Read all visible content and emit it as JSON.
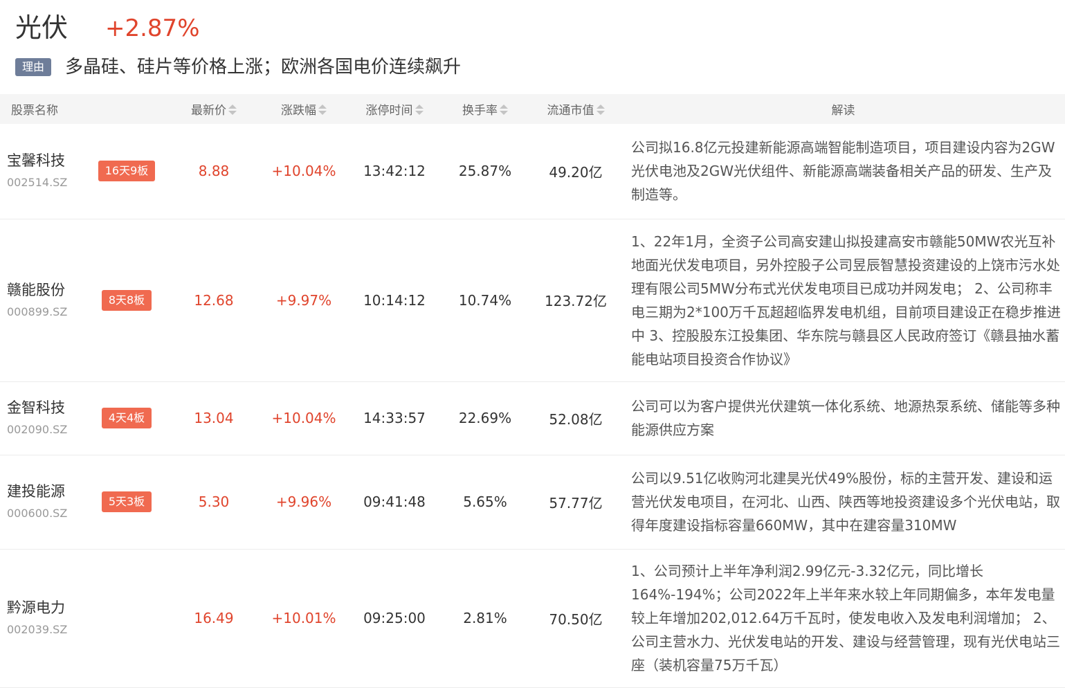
{
  "sector": {
    "name": "光伏",
    "change": "+2.87%",
    "reason_tag": "理由",
    "reason": "多晶硅、硅片等价格上涨；欧洲各国电价连续飙升"
  },
  "table": {
    "headers": {
      "name": "股票名称",
      "price": "最新价",
      "change": "涨跌幅",
      "limit_time": "涨停时间",
      "turnover": "换手率",
      "float_cap": "流通市值",
      "desc": "解读"
    },
    "rows": [
      {
        "name": "宝馨科技",
        "code": "002514.SZ",
        "badge": "16天9板",
        "price": "8.88",
        "change": "+10.04%",
        "limit_time": "13:42:12",
        "turnover": "25.87%",
        "float_cap": "49.20亿",
        "desc": "公司拟16.8亿元投建新能源高端智能制造项目，项目建设内容为2GW光伏电池及2GW光伏组件、新能源高端装备相关产品的研发、生产及制造等。"
      },
      {
        "name": "赣能股份",
        "code": "000899.SZ",
        "badge": "8天8板",
        "price": "12.68",
        "change": "+9.97%",
        "limit_time": "10:14:12",
        "turnover": "10.74%",
        "float_cap": "123.72亿",
        "desc": "1、22年1月，全资子公司高安建山拟投建高安市赣能50MW农光互补地面光伏发电项目，另外控股子公司昱辰智慧投资建设的上饶市污水处理有限公司5MW分布式光伏发电项目已成功并网发电； 2、公司称丰电三期为2*100万千瓦超超临界发电机组，目前项目建设正在稳步推进中 3、控股股东江投集团、华东院与赣县区人民政府签订《赣县抽水蓄能电站项目投资合作协议》"
      },
      {
        "name": "金智科技",
        "code": "002090.SZ",
        "badge": "4天4板",
        "price": "13.04",
        "change": "+10.04%",
        "limit_time": "14:33:57",
        "turnover": "22.69%",
        "float_cap": "52.08亿",
        "desc": "公司可以为客户提供光伏建筑一体化系统、地源热泵系统、储能等多种能源供应方案"
      },
      {
        "name": "建投能源",
        "code": "000600.SZ",
        "badge": "5天3板",
        "price": "5.30",
        "change": "+9.96%",
        "limit_time": "09:41:48",
        "turnover": "5.65%",
        "float_cap": "57.77亿",
        "desc": "公司以9.51亿收购河北建昊光伏49%股份，标的主营开发、建设和运营光伏发电项目，在河北、山西、陕西等地投资建设多个光伏电站，取得年度建设指标容量660MW，其中在建容量310MW"
      },
      {
        "name": "黔源电力",
        "code": "002039.SZ",
        "badge": "",
        "price": "16.49",
        "change": "+10.01%",
        "limit_time": "09:25:00",
        "turnover": "2.81%",
        "float_cap": "70.50亿",
        "desc": "1、公司预计上半年净利润2.99亿元-3.32亿元，同比增长164%-194%；公司2022年上半年来水较上年同期偏多，本年发电量较上年增加202,012.64万千瓦时，使发电收入及发电利润增加； 2、公司主营水力、光伏发电站的开发、建设与经营管理，现有光伏电站三座（装机容量75万千瓦）"
      }
    ]
  },
  "colors": {
    "up": "#e0442c",
    "badge_bg": "#f06a50",
    "reason_tag_bg": "#6e7d99",
    "header_bg": "#f5f5f5"
  }
}
